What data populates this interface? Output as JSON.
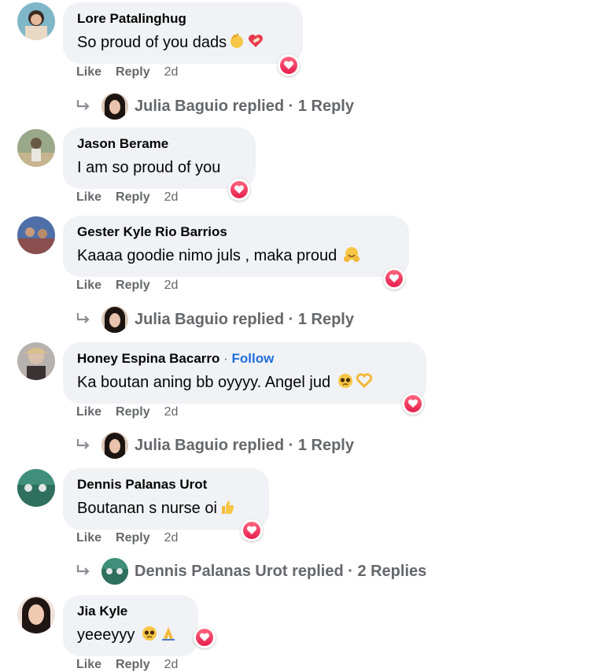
{
  "action_labels": {
    "like": "Like",
    "reply": "Reply"
  },
  "reaction_icon": "heart-icon",
  "colors": {
    "bubble": "#f0f2f5",
    "meta": "#65676b",
    "follow": "#216fdb",
    "heart": "#f33e58"
  },
  "comments": [
    {
      "author": "Lore Patalinghug",
      "text": "So proud of you dads",
      "emojis": [
        "clapping-hands-icon",
        "heart-with-bandage-icon"
      ],
      "time": "2d",
      "reply_summary": {
        "author": "Julia Baguio",
        "verb": "replied",
        "count": "1 Reply"
      }
    },
    {
      "author": "Jason Berame",
      "text": "I am so proud of you",
      "emojis": [],
      "time": "2d"
    },
    {
      "author": "Gester Kyle Rio Barrios",
      "text": "Kaaaa goodie nimo juls , maka proud",
      "emojis": [
        "smiling-face-with-open-hands-icon"
      ],
      "time": "2d",
      "reply_summary": {
        "author": "Julia Baguio",
        "verb": "replied",
        "count": "1 Reply"
      }
    },
    {
      "author": "Honey Espina Bacarro",
      "follow": "Follow",
      "text": "Ka boutan aning bb oyyyy. Angel jud",
      "emojis": [
        "pleading-face-icon",
        "heart-hands-icon"
      ],
      "time": "2d",
      "reply_summary": {
        "author": "Julia Baguio",
        "verb": "replied",
        "count": "1 Reply"
      }
    },
    {
      "author": "Dennis Palanas Urot",
      "text": "Boutanan s nurse oi",
      "emojis": [
        "thumbs-up-icon"
      ],
      "time": "2d",
      "reply_summary": {
        "author": "Dennis Palanas Urot",
        "verb": "replied",
        "count": "2 Replies"
      }
    },
    {
      "author": "Jia Kyle",
      "text": "yeeeyyy",
      "emojis": [
        "pleading-face-icon",
        "folded-hands-icon"
      ],
      "time": "2d"
    }
  ]
}
